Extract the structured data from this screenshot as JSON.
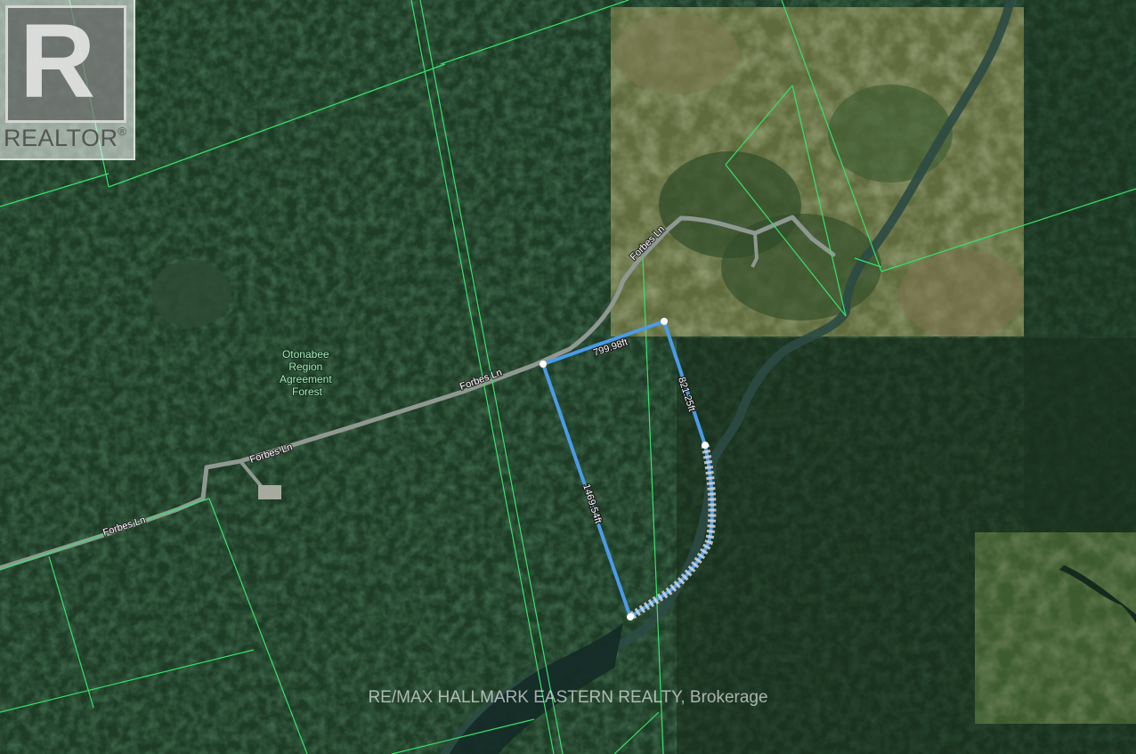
{
  "map": {
    "labels": {
      "road": "Forbes Ln",
      "area": [
        "Otonabee",
        "Region",
        "Agreement",
        "Forest"
      ]
    },
    "measurements": {
      "north_edge": "799.98ft",
      "east_edge": "821.25ft",
      "west_edge": "1469.54ft"
    },
    "colors": {
      "lot_lines": "#35e36a",
      "parcel_outline": "#4a9be8",
      "road": "#9aa39c",
      "forest_dark": "#1c3a24",
      "clearing": "#6f7a4c",
      "river": "#2a4a4c"
    }
  },
  "logo": {
    "letter": "R",
    "word": "REALTOR",
    "mark": "®",
    "icon": "realtor-logo-icon"
  },
  "watermark": {
    "text": "RE/MAX HALLMARK EASTERN REALTY, Brokerage"
  }
}
